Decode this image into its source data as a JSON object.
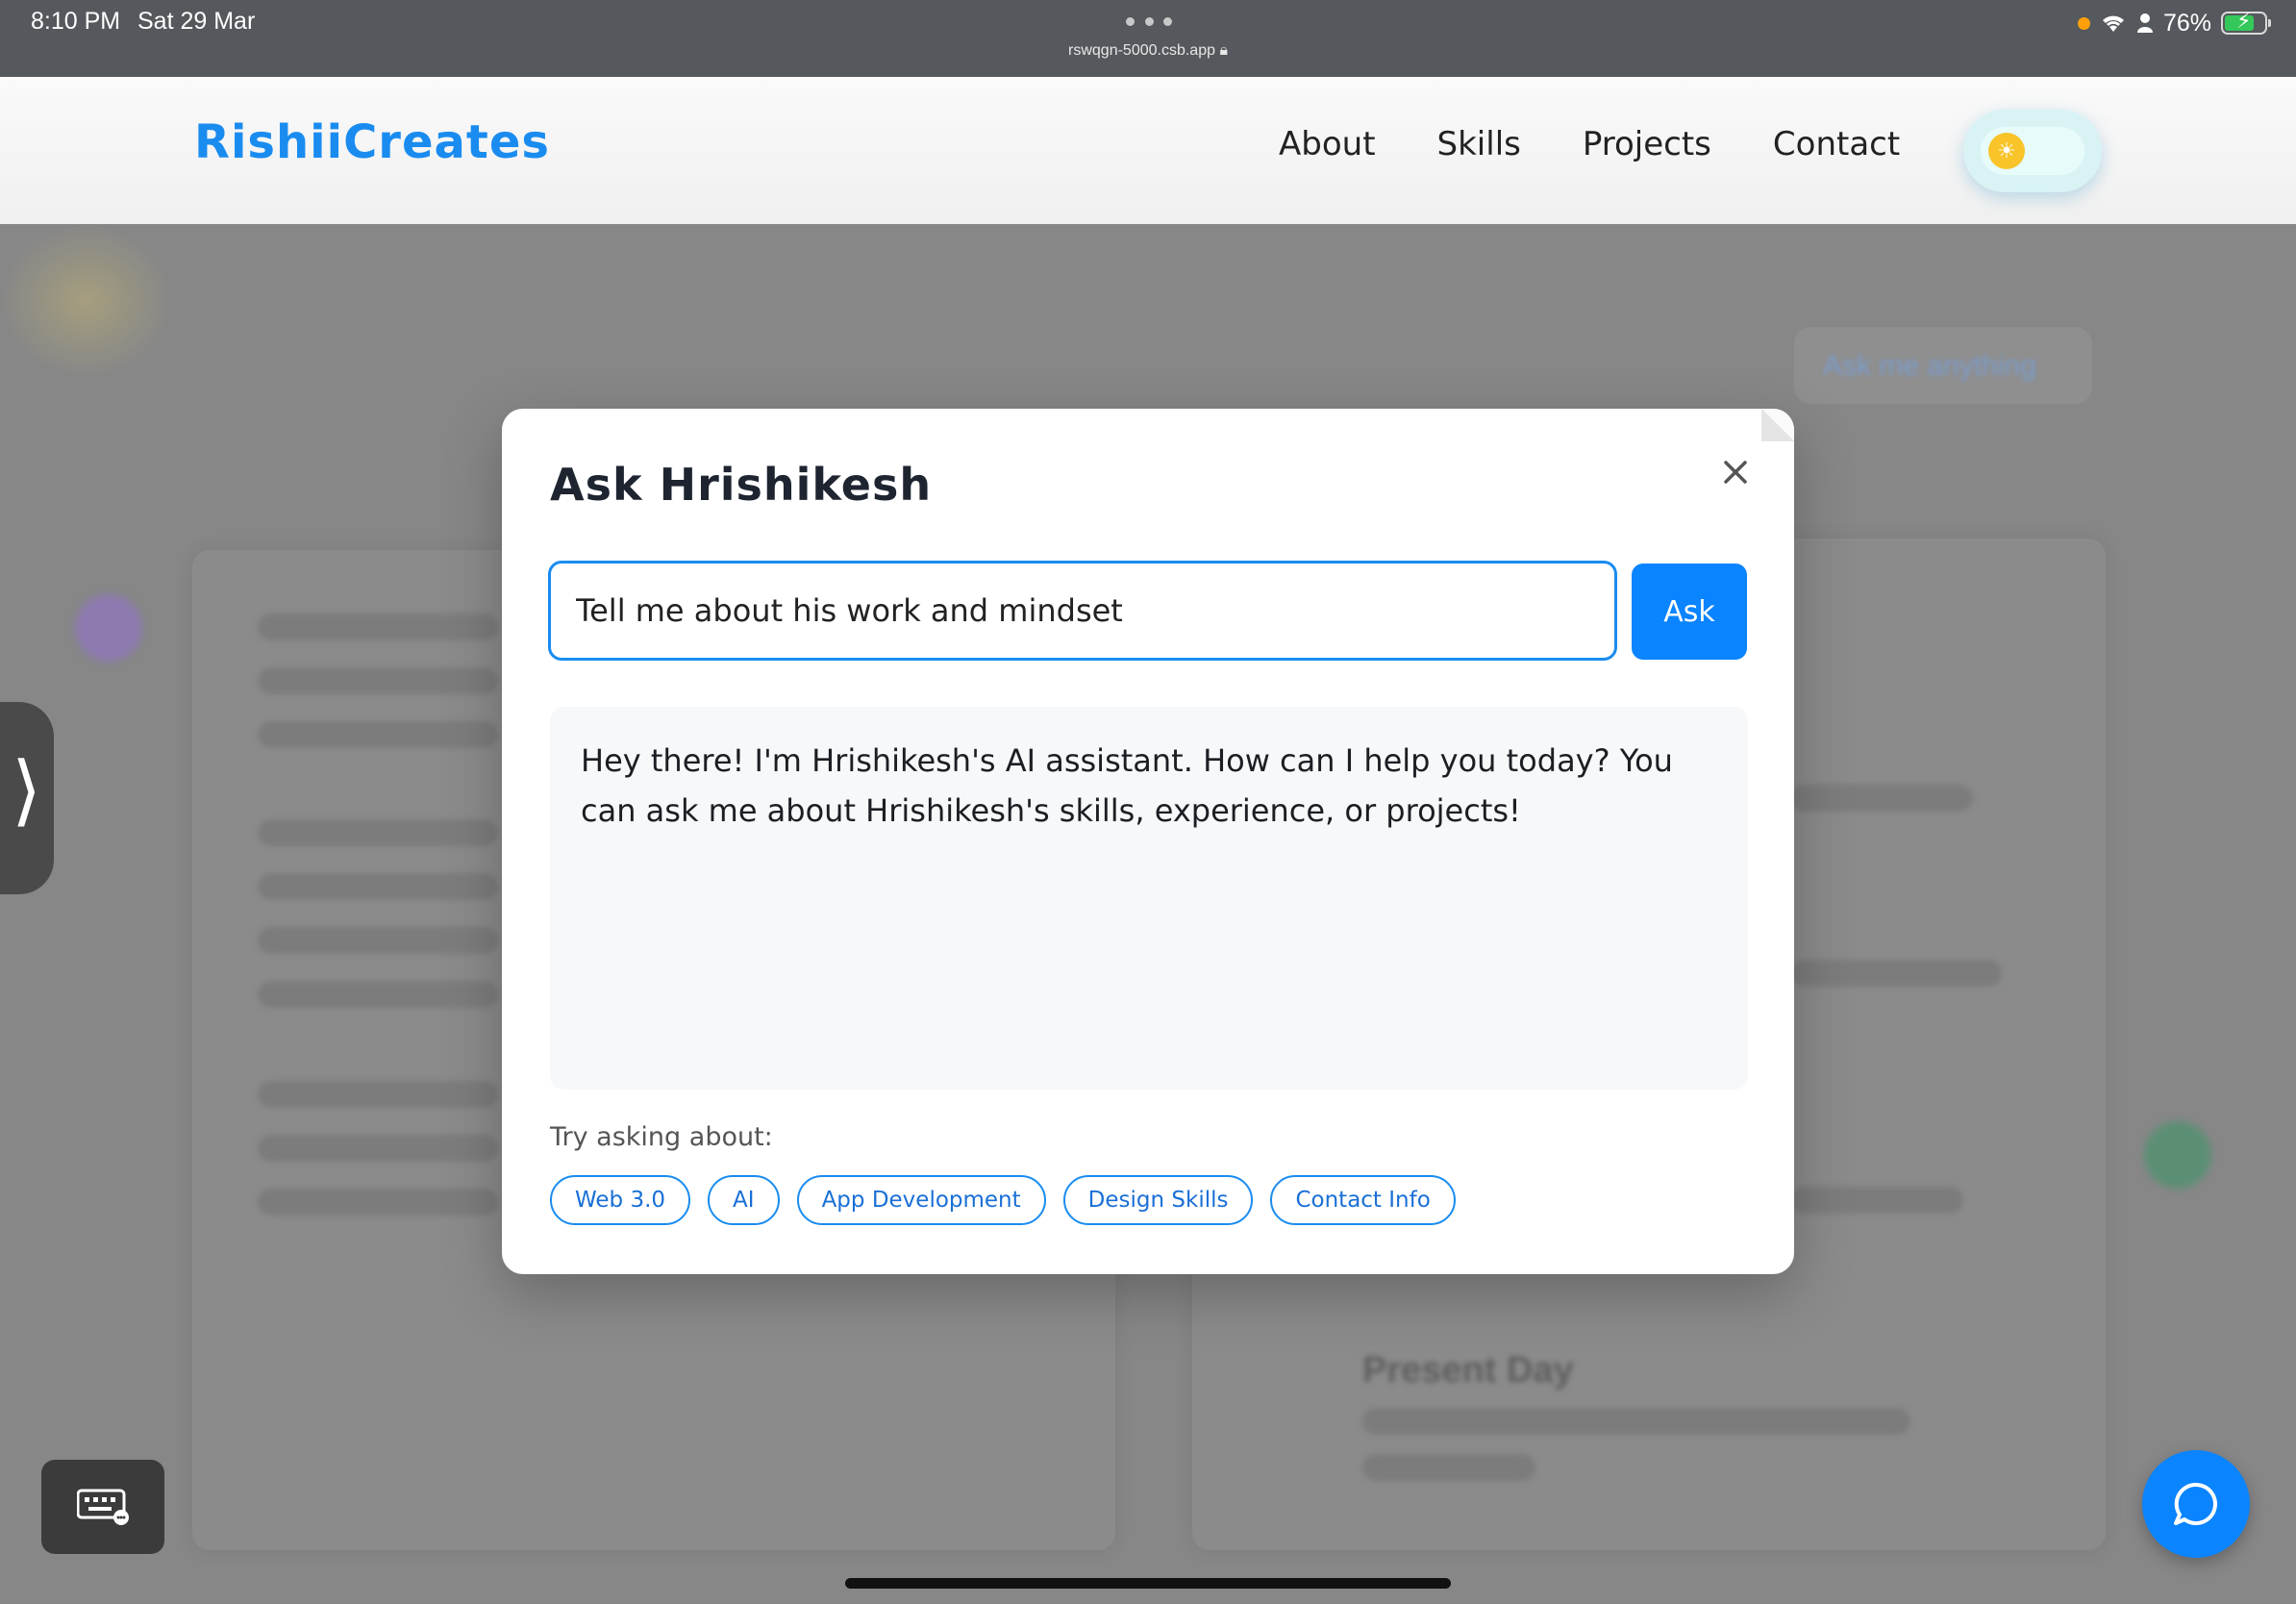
{
  "status_bar": {
    "time": "8:10 PM",
    "date": "Sat 29 Mar",
    "url": "rswqgn-5000.csb.app",
    "battery": "76%",
    "battery_level": 0.76
  },
  "header": {
    "brand": "RishiiCreates",
    "nav": [
      "About",
      "Skills",
      "Projects",
      "Contact"
    ],
    "theme": "light"
  },
  "background": {
    "ask_button_label": "Ask me anything",
    "timeline_heading": "Present Day"
  },
  "modal": {
    "title": "Ask Hrishikesh",
    "input_value": "Tell me about his work and mindset",
    "ask_label": "Ask",
    "response": "Hey there! I'm Hrishikesh's AI assistant. How can I help you today? You can ask me about Hrishikesh's skills, experience, or projects!",
    "try_label": "Try asking about:",
    "suggestions": [
      "Web 3.0",
      "AI",
      "App Development",
      "Design Skills",
      "Contact Info"
    ]
  },
  "colors": {
    "accent": "#0a84ff",
    "brand": "#1a8cf0",
    "overlay": "#878787"
  }
}
